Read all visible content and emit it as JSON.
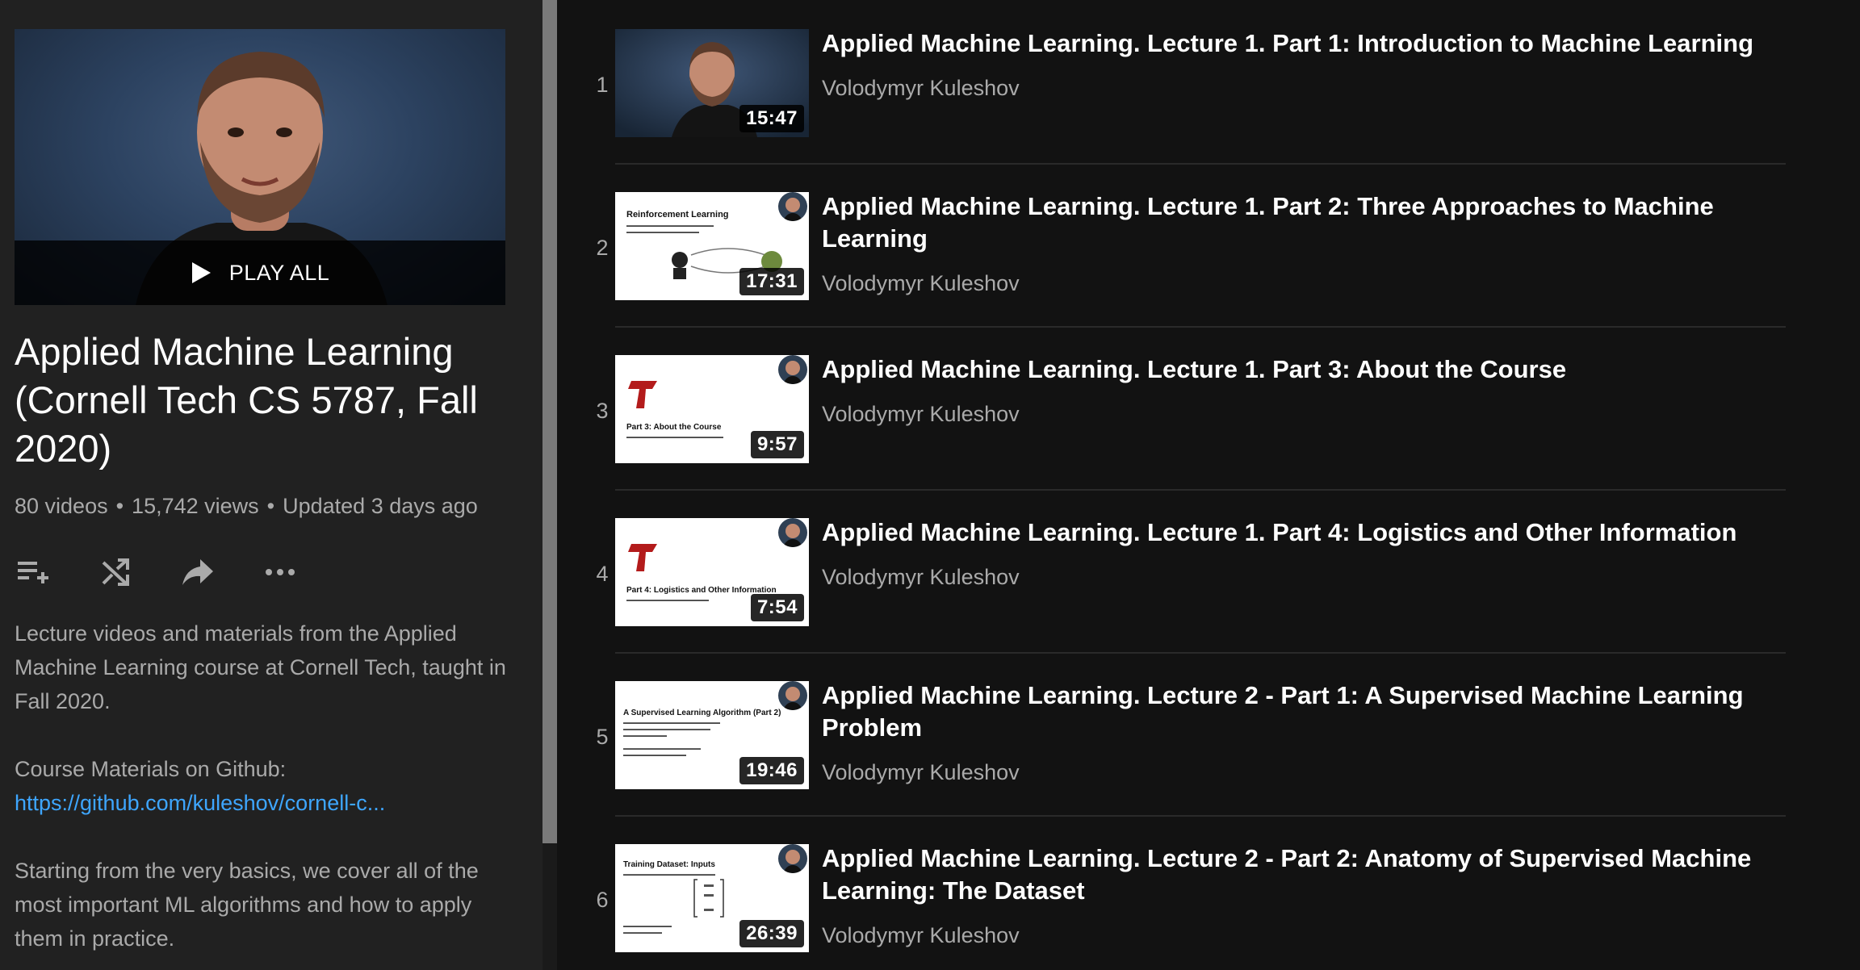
{
  "playlist": {
    "play_all_label": "PLAY ALL",
    "title": "Applied Machine Learning (Cornell Tech CS 5787, Fall 2020)",
    "stats": {
      "videos": "80 videos",
      "sep1": "•",
      "views": "15,742 views",
      "sep2": "•",
      "updated": "Updated 3 days ago"
    },
    "actions": [
      "add-to-queue-icon",
      "shuffle-icon",
      "share-icon",
      "more-icon"
    ],
    "description": {
      "para1": "Lecture videos and materials from the Applied Machine Learning course at Cornell Tech, taught in Fall 2020.",
      "materials_label": "Course Materials on Github:",
      "materials_link": "https://github.com/kuleshov/cornell-c...",
      "para3": "Starting from the very basics, we cover all of the most important ML algorithms and how to apply them in practice."
    }
  },
  "videos": [
    {
      "index": "1",
      "title": "Applied Machine Learning. Lecture 1. Part 1: Introduction to Machine Learning",
      "channel": "Volodymyr Kuleshov",
      "duration": "15:47"
    },
    {
      "index": "2",
      "title": "Applied Machine Learning. Lecture 1. Part 2: Three Approaches to Machine Learning",
      "channel": "Volodymyr Kuleshov",
      "duration": "17:31",
      "slide_title": "Reinforcement Learning"
    },
    {
      "index": "3",
      "title": "Applied Machine Learning. Lecture 1. Part 3: About the Course",
      "channel": "Volodymyr Kuleshov",
      "duration": "9:57",
      "slide_title": "Part 3: About the Course"
    },
    {
      "index": "4",
      "title": "Applied Machine Learning. Lecture 1. Part 4: Logistics and Other Information",
      "channel": "Volodymyr Kuleshov",
      "duration": "7:54",
      "slide_title": "Part 4: Logistics and Other Information"
    },
    {
      "index": "5",
      "title": "Applied Machine Learning. Lecture 2 - Part 1: A Supervised Machine Learning Problem",
      "channel": "Volodymyr Kuleshov",
      "duration": "19:46",
      "slide_title": "A Supervised Learning Algorithm (Part 2)"
    },
    {
      "index": "6",
      "title": "Applied Machine Learning. Lecture 2 - Part 2: Anatomy of Supervised Machine Learning: The Dataset",
      "channel": "Volodymyr Kuleshov",
      "duration": "26:39",
      "slide_title": "Training Dataset: Inputs"
    }
  ],
  "colors": {
    "link": "#3ea6ff",
    "secondary_text": "#aaaaaa",
    "sidebar_bg": "#212121",
    "list_bg": "#121212",
    "cornell_red": "#b31b1b"
  }
}
